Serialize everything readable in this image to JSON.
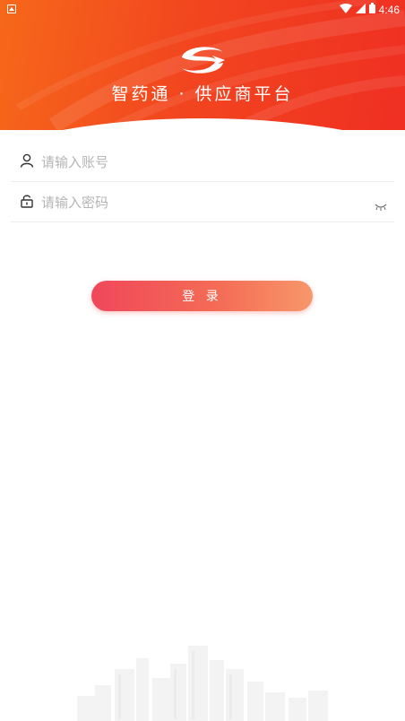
{
  "status_bar": {
    "time": "4:46"
  },
  "header": {
    "title": "智药通 · 供应商平台"
  },
  "form": {
    "account_placeholder": "请输入账号",
    "password_placeholder": "请输入密码",
    "login_label": "登 录"
  },
  "colors": {
    "header_gradient": [
      "#f6681a",
      "#ef2f22"
    ],
    "button_gradient": [
      "#f0475b",
      "#f7976a"
    ]
  },
  "icons": {
    "account": "user-icon",
    "password": "lock-icon",
    "visibility": "eye-closed-icon",
    "logo": "zhiyaotong-logo"
  }
}
